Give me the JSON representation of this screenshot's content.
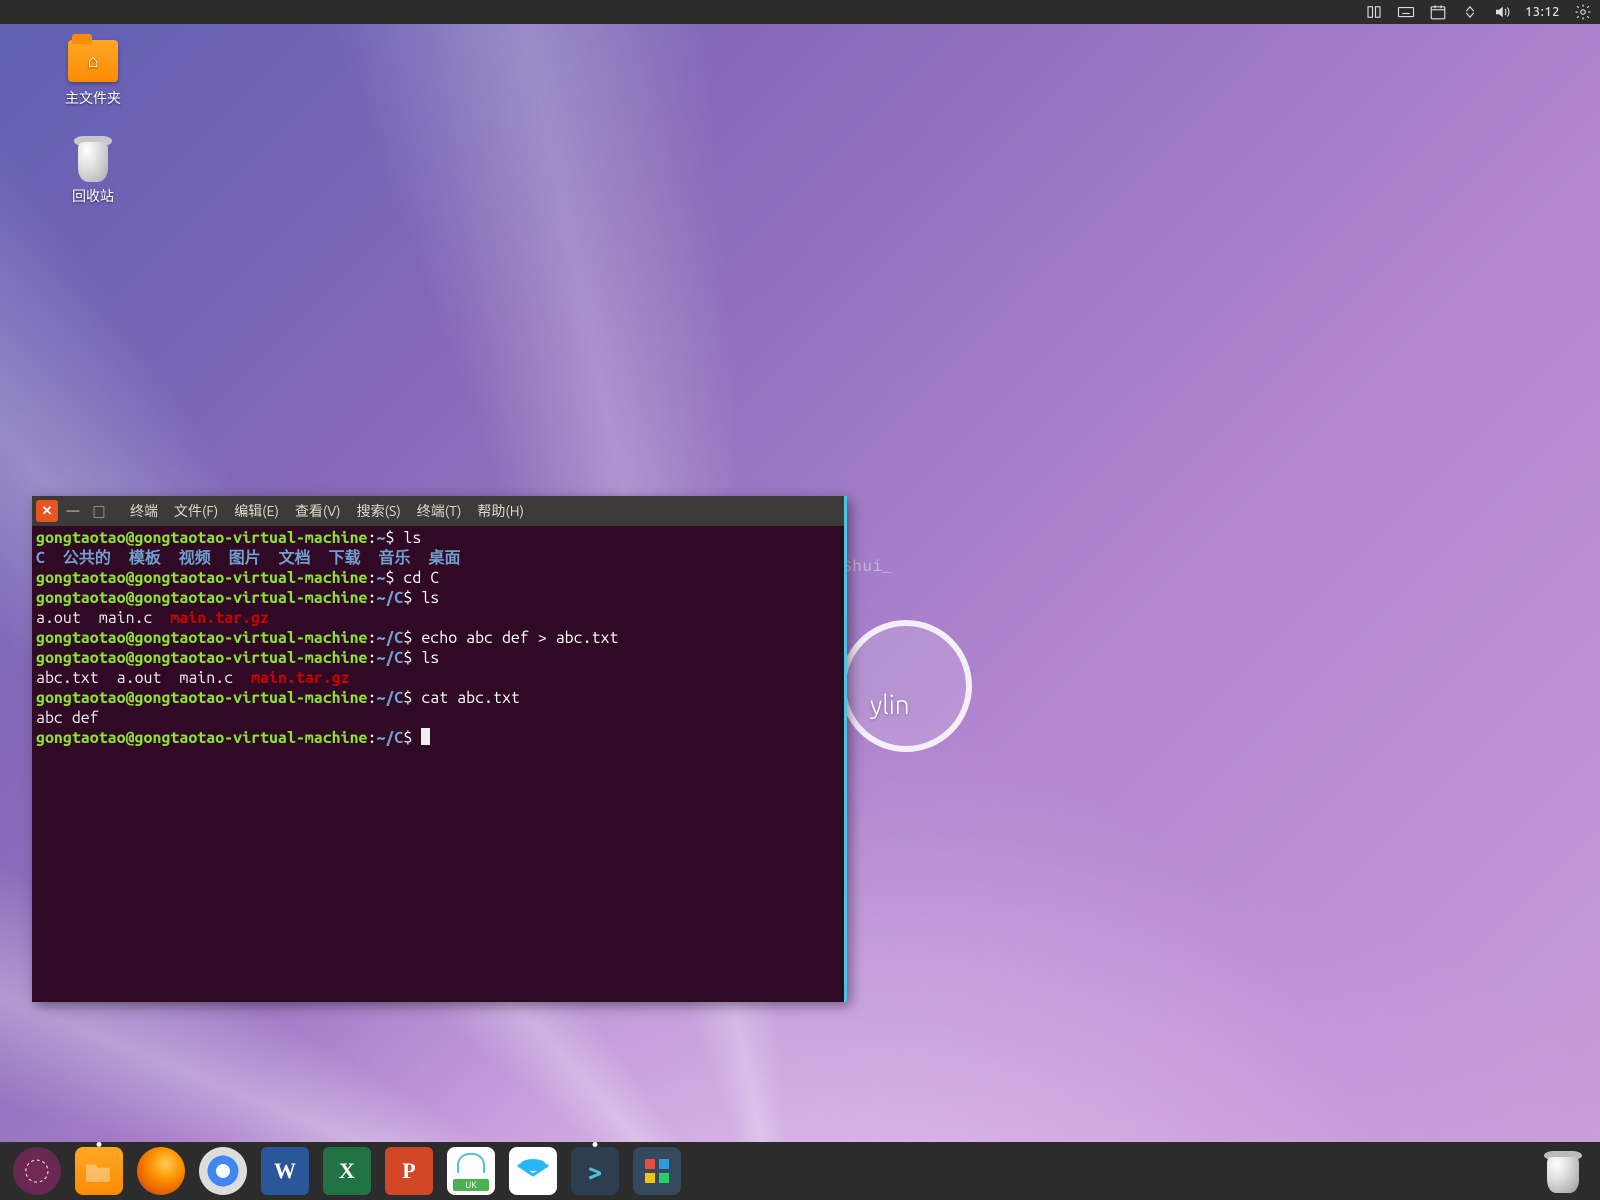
{
  "top_panel": {
    "clock": "13:12"
  },
  "desktop_icons": {
    "home_label": "主文件夹",
    "trash_label": "回收站"
  },
  "watermark": "http://blog.csdn.net/Shui_",
  "kylin_text": "ylin",
  "terminal": {
    "title": "终端",
    "menu": {
      "file": "文件(F)",
      "edit": "编辑(E)",
      "view": "查看(V)",
      "search": "搜索(S)",
      "terminal": "终端(T)",
      "help": "帮助(H)"
    },
    "prompt": {
      "user_host": "gongtaotao@gongtaotao-virtual-machine",
      "home": "~",
      "cwd": "~/C"
    },
    "cmds": {
      "ls": "ls",
      "cd": "cd C",
      "echo": "echo abc def > abc.txt",
      "cat": "cat abc.txt"
    },
    "listing1": {
      "c": "C",
      "pub": "公共的",
      "tpl": "模板",
      "vid": "视频",
      "pic": "图片",
      "doc": "文档",
      "dl": "下载",
      "mus": "音乐",
      "desk": "桌面"
    },
    "listing2": {
      "aout": "a.out",
      "mainc": "main.c",
      "tar": "main.tar.gz"
    },
    "listing3": {
      "abctxt": "abc.txt",
      "aout": "a.out",
      "mainc": "main.c",
      "tar": "main.tar.gz"
    },
    "cat_out": "abc def"
  },
  "dock": {
    "word": "W",
    "excel": "X",
    "ppt": "P",
    "store_badge": "UK",
    "term_glyph": ">",
    "ubuntu_glyph": "◌"
  }
}
